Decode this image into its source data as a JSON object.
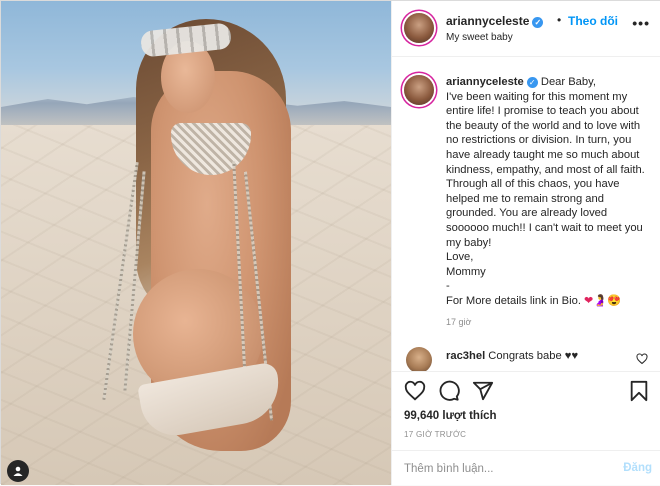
{
  "header": {
    "username": "ariannyceleste",
    "separator": "•",
    "follow_label": "Theo dõi",
    "subtitle": "My sweet baby",
    "more_label": "•••"
  },
  "caption": {
    "username": "ariannyceleste",
    "text": "Dear Baby,\nI've been waiting for this moment my entire life! I promise to teach you about the beauty of the world and to love with no restrictions or division. In turn, you have already taught me so much about kindness, empathy, and most of all faith. Through all of this chaos, you have helped me to remain strong and grounded. You are already loved soooooo much!! I can't wait to meet you my baby!\nLove,\nMommy\n-\nFor More details link in Bio. ",
    "emoji": "❤🤰😍",
    "time": "17 giờ"
  },
  "comments": [
    {
      "username": "rac3hel",
      "text": "Congrats babe ♥♥"
    }
  ],
  "actions": {
    "likes": "99,640 lượt thích",
    "time": "17 GIỜ TRƯỚC"
  },
  "add_comment": {
    "placeholder": "Thêm bình luận...",
    "post_label": "Đăng"
  },
  "colors": {
    "accent": "#0095f6",
    "verified": "#3897f0",
    "post_disabled": "#b2dffc"
  },
  "icons": [
    "verified-icon",
    "more-icon",
    "heart-icon",
    "comment-icon",
    "share-icon",
    "bookmark-icon",
    "user-tag-icon"
  ]
}
